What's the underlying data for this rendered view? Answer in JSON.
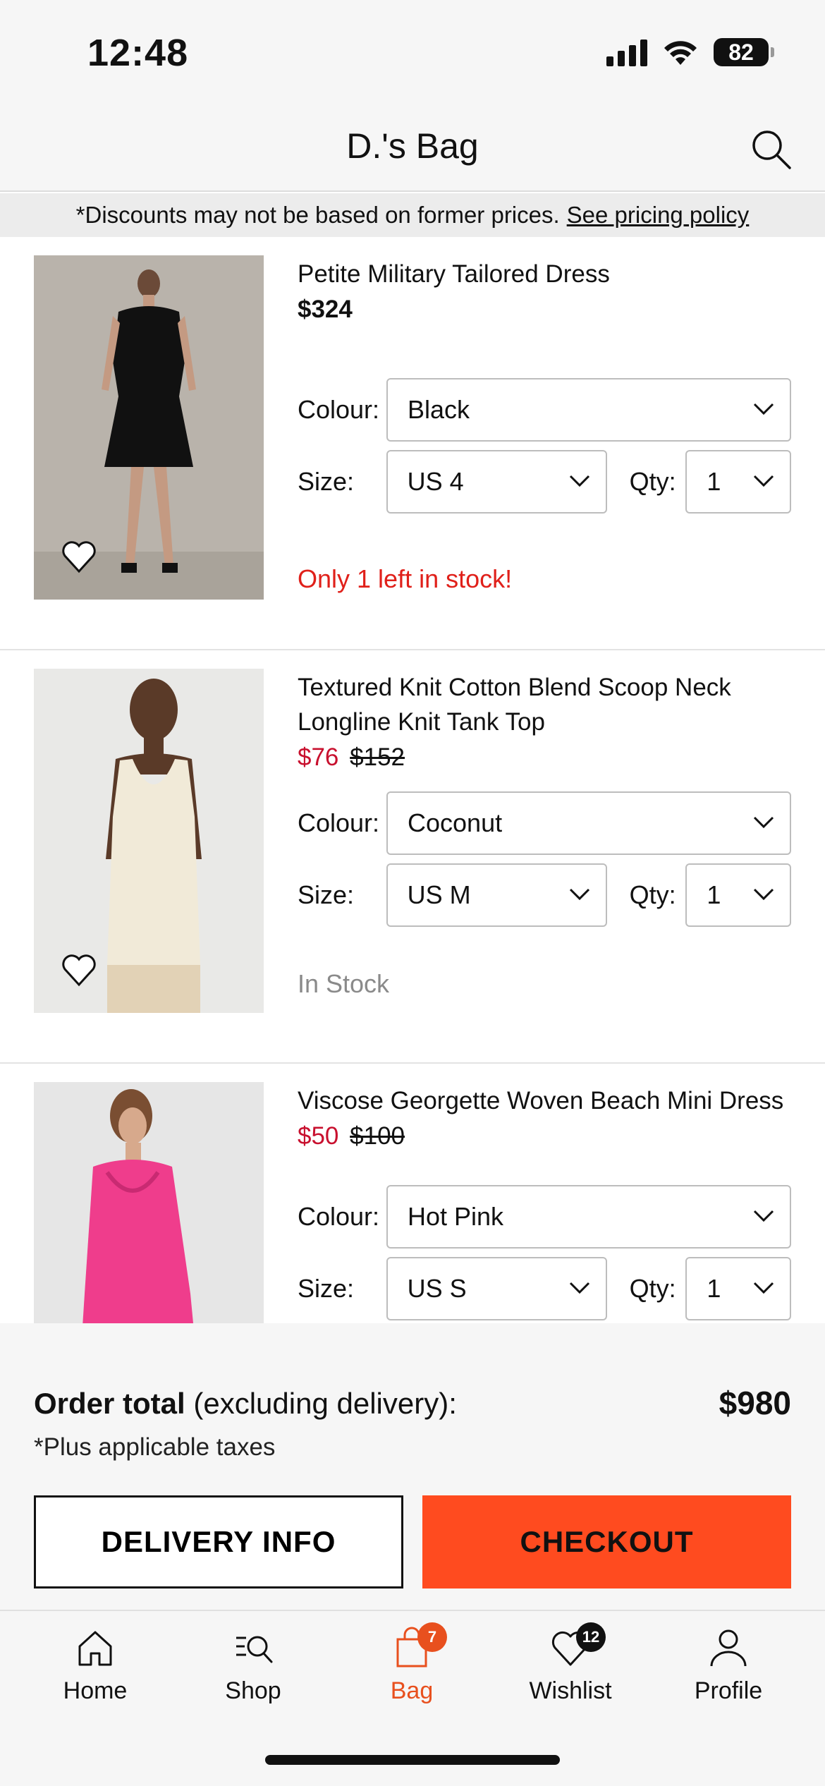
{
  "status_bar": {
    "time": "12:48",
    "battery": "82"
  },
  "header": {
    "title": "D.'s Bag"
  },
  "banner": {
    "text": "*Discounts may not be based on former prices.",
    "link": "See pricing policy"
  },
  "labels": {
    "colour": "Colour:",
    "size": "Size:",
    "qty": "Qty:"
  },
  "products": [
    {
      "name": "Petite Military Tailored Dress",
      "price": "$324",
      "colour": "Black",
      "size": "US 4",
      "qty": "1",
      "stock": "Only 1 left in stock!"
    },
    {
      "name": "Textured Knit Cotton Blend Scoop Neck Longline Knit Tank Top",
      "sale_price": "$76",
      "old_price": "$152",
      "colour": "Coconut",
      "size": "US M",
      "qty": "1",
      "stock": "In Stock"
    },
    {
      "name": "Viscose Georgette Woven Beach Mini Dress",
      "sale_price": "$50",
      "old_price": "$100",
      "colour": "Hot Pink",
      "size": "US S",
      "qty": "1"
    }
  ],
  "order": {
    "total_label": "Order total",
    "total_suffix": "(excluding delivery):",
    "amount": "$980",
    "tax_note": "*Plus applicable taxes",
    "delivery_button": "DELIVERY INFO",
    "checkout_button": "CHECKOUT"
  },
  "tabs": [
    {
      "label": "Home",
      "icon": "home-icon"
    },
    {
      "label": "Shop",
      "icon": "shop-search-icon"
    },
    {
      "label": "Bag",
      "icon": "bag-icon",
      "badge": "7",
      "active": true
    },
    {
      "label": "Wishlist",
      "icon": "heart-icon",
      "badge": "12"
    },
    {
      "label": "Profile",
      "icon": "profile-icon"
    }
  ],
  "colors": {
    "accent": "#ff4b1f",
    "sale": "#c8102e",
    "low_stock": "#e0201a",
    "active_tab": "#e8501e"
  }
}
